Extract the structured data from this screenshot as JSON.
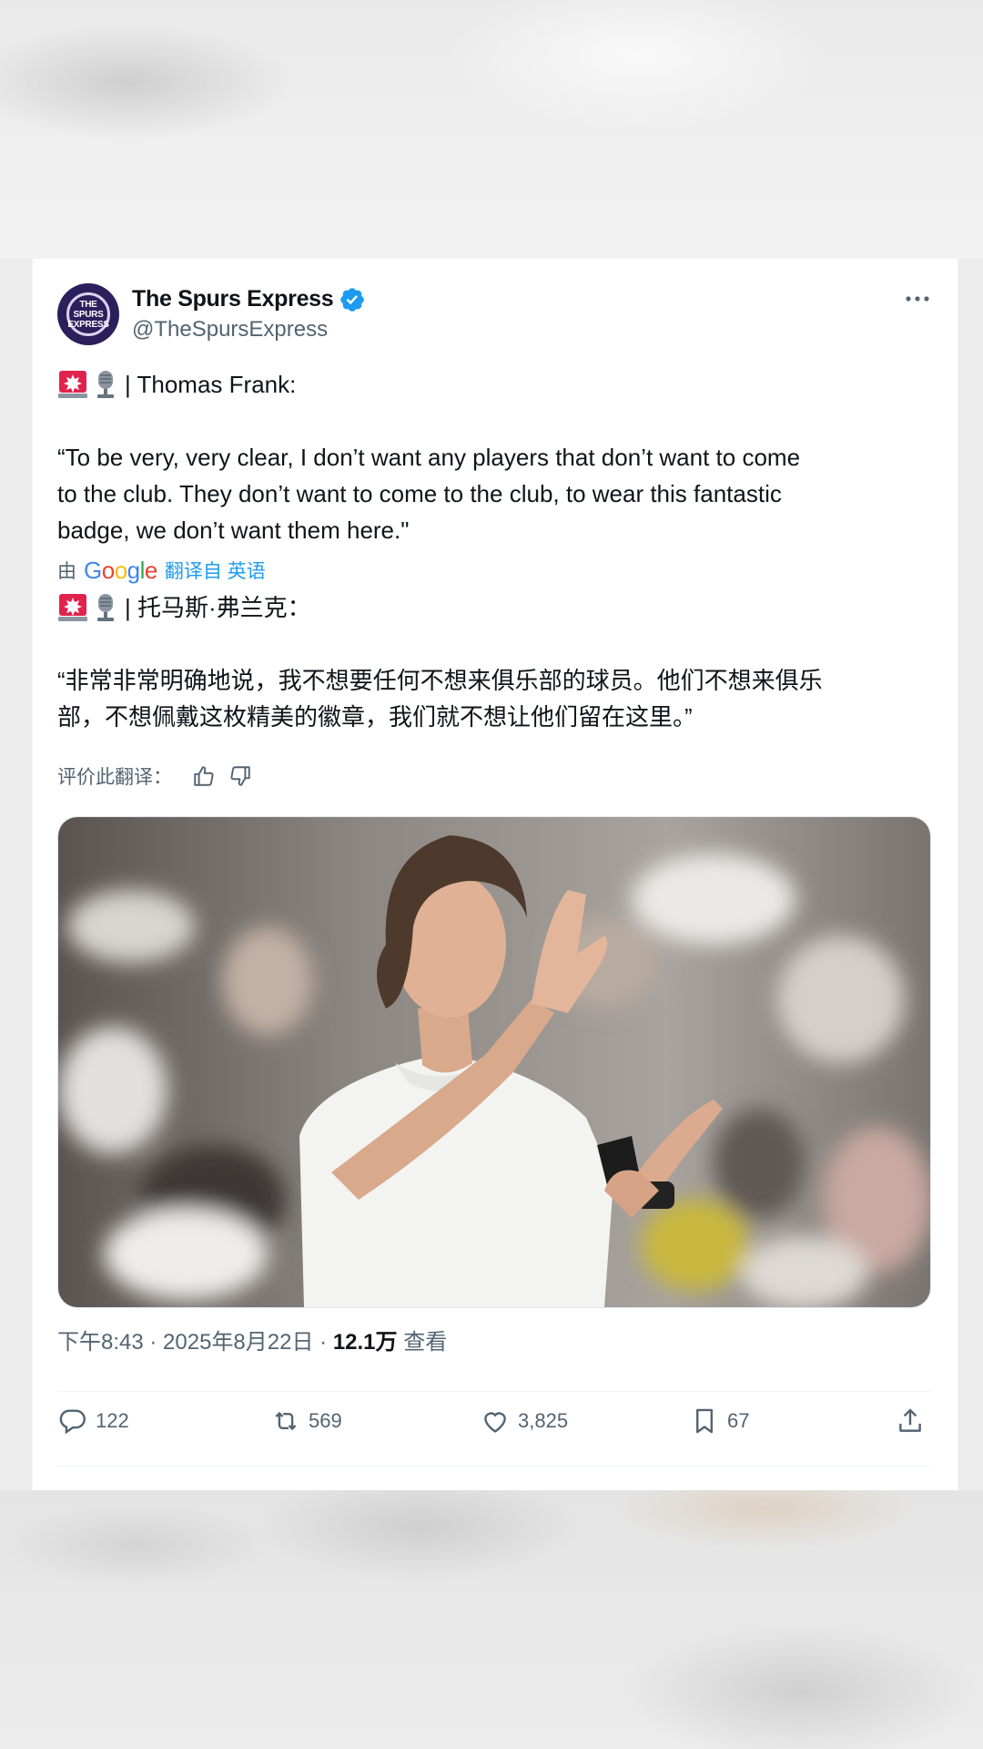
{
  "tweet": {
    "display_name": "The Spurs Express",
    "handle": "@TheSpursExpress",
    "avatar_text": [
      "THE",
      "SPURS",
      "EXPRESS"
    ],
    "more_icon": "more-horizontal-icon",
    "original": {
      "speaker_line": "| Thomas Frank:",
      "quote_lines": [
        "“To be very, very clear, I don’t want any players that don’t want to come",
        "to the club. They don’t want to come to the club, to wear this fantastic",
        "badge, we don’t want them here.\""
      ]
    },
    "translation_bar": {
      "prefix": "由",
      "provider": "Google",
      "link": "翻译自 英语"
    },
    "translated": {
      "speaker_line": "| 托马斯·弗兰克：",
      "quote_lines": [
        "“非常非常明确地说，我不想要任何不想来俱乐部的球员。他们不想来俱乐",
        "部，不想佩戴这枚精美的徽章，我们就不想让他们留在这里。”"
      ]
    },
    "rate_translation": "评价此翻译：",
    "meta": {
      "time": "下午8:43",
      "sep1": " · ",
      "date": "2025年8月22日",
      "sep2": " · ",
      "views": "12.1万",
      "views_label": " 查看"
    },
    "actions": {
      "replies": "122",
      "reposts": "569",
      "likes": "3,825",
      "bookmarks": "67"
    },
    "colors": {
      "verified": "#1d9bf0",
      "text": "#0f1419",
      "secondary": "#536471",
      "link": "#1d9bf0"
    }
  }
}
